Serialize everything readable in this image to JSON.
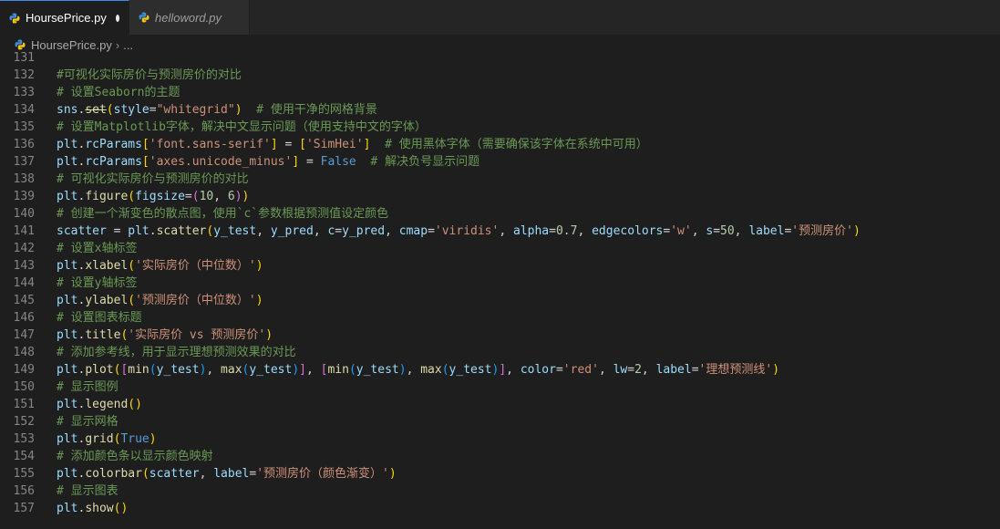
{
  "tabs": [
    {
      "label": "HoursePrice.py",
      "active": true,
      "modified": true
    },
    {
      "label": "helloword.py",
      "active": false,
      "modified": false
    }
  ],
  "breadcrumb": {
    "file": "HoursePrice.py",
    "sep": "›",
    "more": "..."
  },
  "colors": {
    "background": "#1e1e1e",
    "comment": "#6a9955",
    "variable": "#9cdcfe",
    "function": "#dcdcaa",
    "string": "#ce9178",
    "number": "#b5cea8",
    "keyword": "#569cd6"
  },
  "icons": {
    "file_icon": "python-icon",
    "modified_indicator": "dot"
  },
  "editor": {
    "lines": [
      {
        "num": "131",
        "tokens": []
      },
      {
        "num": "132",
        "tokens": [
          {
            "t": "#可视化实际房价与预测房价的对比",
            "c": "c-cm"
          }
        ]
      },
      {
        "num": "133",
        "tokens": [
          {
            "t": "# 设置Seaborn的主题",
            "c": "c-cm"
          }
        ]
      },
      {
        "num": "134",
        "tokens": [
          {
            "t": "sns",
            "c": "c-var"
          },
          {
            "t": ".",
            "c": "c-pl"
          },
          {
            "t": "set",
            "c": "c-fn strike"
          },
          {
            "t": "(",
            "c": "c-br1"
          },
          {
            "t": "style",
            "c": "c-var"
          },
          {
            "t": "=",
            "c": "c-pl"
          },
          {
            "t": "\"whitegrid\"",
            "c": "c-str"
          },
          {
            "t": ")",
            "c": "c-br1"
          },
          {
            "t": "  # 使用干净的网格背景",
            "c": "c-cm"
          }
        ]
      },
      {
        "num": "135",
        "tokens": [
          {
            "t": "# 设置Matplotlib字体，解决中文显示问题（使用支持中文的字体）",
            "c": "c-cm"
          }
        ]
      },
      {
        "num": "136",
        "tokens": [
          {
            "t": "plt",
            "c": "c-var"
          },
          {
            "t": ".",
            "c": "c-pl"
          },
          {
            "t": "rcParams",
            "c": "c-var"
          },
          {
            "t": "[",
            "c": "c-br1"
          },
          {
            "t": "'font.sans-serif'",
            "c": "c-str"
          },
          {
            "t": "]",
            "c": "c-br1"
          },
          {
            "t": " = ",
            "c": "c-pl"
          },
          {
            "t": "[",
            "c": "c-br1"
          },
          {
            "t": "'SimHei'",
            "c": "c-str"
          },
          {
            "t": "]",
            "c": "c-br1"
          },
          {
            "t": "  # 使用黑体字体（需要确保该字体在系统中可用）",
            "c": "c-cm"
          }
        ]
      },
      {
        "num": "137",
        "tokens": [
          {
            "t": "plt",
            "c": "c-var"
          },
          {
            "t": ".",
            "c": "c-pl"
          },
          {
            "t": "rcParams",
            "c": "c-var"
          },
          {
            "t": "[",
            "c": "c-br1"
          },
          {
            "t": "'axes.unicode_minus'",
            "c": "c-str"
          },
          {
            "t": "]",
            "c": "c-br1"
          },
          {
            "t": " = ",
            "c": "c-pl"
          },
          {
            "t": "False",
            "c": "c-kw"
          },
          {
            "t": "  # 解决负号显示问题",
            "c": "c-cm"
          }
        ]
      },
      {
        "num": "138",
        "tokens": [
          {
            "t": "# 可视化实际房价与预测房价的对比",
            "c": "c-cm"
          }
        ]
      },
      {
        "num": "139",
        "tokens": [
          {
            "t": "plt",
            "c": "c-var"
          },
          {
            "t": ".",
            "c": "c-pl"
          },
          {
            "t": "figure",
            "c": "c-fn"
          },
          {
            "t": "(",
            "c": "c-br1"
          },
          {
            "t": "figsize",
            "c": "c-var"
          },
          {
            "t": "=",
            "c": "c-pl"
          },
          {
            "t": "(",
            "c": "c-br2"
          },
          {
            "t": "10",
            "c": "c-num"
          },
          {
            "t": ", ",
            "c": "c-pl"
          },
          {
            "t": "6",
            "c": "c-num"
          },
          {
            "t": ")",
            "c": "c-br2"
          },
          {
            "t": ")",
            "c": "c-br1"
          }
        ]
      },
      {
        "num": "140",
        "tokens": [
          {
            "t": "# 创建一个渐变色的散点图，使用`c`参数根据预测值设定颜色",
            "c": "c-cm"
          }
        ]
      },
      {
        "num": "141",
        "tokens": [
          {
            "t": "scatter",
            "c": "c-var"
          },
          {
            "t": " = ",
            "c": "c-pl"
          },
          {
            "t": "plt",
            "c": "c-var"
          },
          {
            "t": ".",
            "c": "c-pl"
          },
          {
            "t": "scatter",
            "c": "c-fn"
          },
          {
            "t": "(",
            "c": "c-br1"
          },
          {
            "t": "y_test",
            "c": "c-var"
          },
          {
            "t": ", ",
            "c": "c-pl"
          },
          {
            "t": "y_pred",
            "c": "c-var"
          },
          {
            "t": ", ",
            "c": "c-pl"
          },
          {
            "t": "c",
            "c": "c-var"
          },
          {
            "t": "=",
            "c": "c-pl"
          },
          {
            "t": "y_pred",
            "c": "c-var"
          },
          {
            "t": ", ",
            "c": "c-pl"
          },
          {
            "t": "cmap",
            "c": "c-var"
          },
          {
            "t": "=",
            "c": "c-pl"
          },
          {
            "t": "'viridis'",
            "c": "c-str"
          },
          {
            "t": ", ",
            "c": "c-pl"
          },
          {
            "t": "alpha",
            "c": "c-var"
          },
          {
            "t": "=",
            "c": "c-pl"
          },
          {
            "t": "0.7",
            "c": "c-num"
          },
          {
            "t": ", ",
            "c": "c-pl"
          },
          {
            "t": "edgecolors",
            "c": "c-var"
          },
          {
            "t": "=",
            "c": "c-pl"
          },
          {
            "t": "'w'",
            "c": "c-str"
          },
          {
            "t": ", ",
            "c": "c-pl"
          },
          {
            "t": "s",
            "c": "c-var"
          },
          {
            "t": "=",
            "c": "c-pl"
          },
          {
            "t": "50",
            "c": "c-num"
          },
          {
            "t": ", ",
            "c": "c-pl"
          },
          {
            "t": "label",
            "c": "c-var"
          },
          {
            "t": "=",
            "c": "c-pl"
          },
          {
            "t": "'预测房价'",
            "c": "c-str"
          },
          {
            "t": ")",
            "c": "c-br1"
          }
        ]
      },
      {
        "num": "142",
        "tokens": [
          {
            "t": "# 设置x轴标签",
            "c": "c-cm"
          }
        ]
      },
      {
        "num": "143",
        "tokens": [
          {
            "t": "plt",
            "c": "c-var"
          },
          {
            "t": ".",
            "c": "c-pl"
          },
          {
            "t": "xlabel",
            "c": "c-fn"
          },
          {
            "t": "(",
            "c": "c-br1"
          },
          {
            "t": "'实际房价（中位数）'",
            "c": "c-str"
          },
          {
            "t": ")",
            "c": "c-br1"
          }
        ]
      },
      {
        "num": "144",
        "tokens": [
          {
            "t": "# 设置y轴标签",
            "c": "c-cm"
          }
        ]
      },
      {
        "num": "145",
        "tokens": [
          {
            "t": "plt",
            "c": "c-var"
          },
          {
            "t": ".",
            "c": "c-pl"
          },
          {
            "t": "ylabel",
            "c": "c-fn"
          },
          {
            "t": "(",
            "c": "c-br1"
          },
          {
            "t": "'预测房价（中位数）'",
            "c": "c-str"
          },
          {
            "t": ")",
            "c": "c-br1"
          }
        ]
      },
      {
        "num": "146",
        "tokens": [
          {
            "t": "# 设置图表标题",
            "c": "c-cm"
          }
        ]
      },
      {
        "num": "147",
        "tokens": [
          {
            "t": "plt",
            "c": "c-var"
          },
          {
            "t": ".",
            "c": "c-pl"
          },
          {
            "t": "title",
            "c": "c-fn"
          },
          {
            "t": "(",
            "c": "c-br1"
          },
          {
            "t": "'实际房价 vs 预测房价'",
            "c": "c-str"
          },
          {
            "t": ")",
            "c": "c-br1"
          }
        ]
      },
      {
        "num": "148",
        "tokens": [
          {
            "t": "# 添加参考线，用于显示理想预测效果的对比",
            "c": "c-cm"
          }
        ]
      },
      {
        "num": "149",
        "tokens": [
          {
            "t": "plt",
            "c": "c-var"
          },
          {
            "t": ".",
            "c": "c-pl"
          },
          {
            "t": "plot",
            "c": "c-fn"
          },
          {
            "t": "(",
            "c": "c-br1"
          },
          {
            "t": "[",
            "c": "c-br2"
          },
          {
            "t": "min",
            "c": "c-fn"
          },
          {
            "t": "(",
            "c": "c-br3"
          },
          {
            "t": "y_test",
            "c": "c-var"
          },
          {
            "t": ")",
            "c": "c-br3"
          },
          {
            "t": ", ",
            "c": "c-pl"
          },
          {
            "t": "max",
            "c": "c-fn"
          },
          {
            "t": "(",
            "c": "c-br3"
          },
          {
            "t": "y_test",
            "c": "c-var"
          },
          {
            "t": ")",
            "c": "c-br3"
          },
          {
            "t": "]",
            "c": "c-br2"
          },
          {
            "t": ", ",
            "c": "c-pl"
          },
          {
            "t": "[",
            "c": "c-br2"
          },
          {
            "t": "min",
            "c": "c-fn"
          },
          {
            "t": "(",
            "c": "c-br3"
          },
          {
            "t": "y_test",
            "c": "c-var"
          },
          {
            "t": ")",
            "c": "c-br3"
          },
          {
            "t": ", ",
            "c": "c-pl"
          },
          {
            "t": "max",
            "c": "c-fn"
          },
          {
            "t": "(",
            "c": "c-br3"
          },
          {
            "t": "y_test",
            "c": "c-var"
          },
          {
            "t": ")",
            "c": "c-br3"
          },
          {
            "t": "]",
            "c": "c-br2"
          },
          {
            "t": ", ",
            "c": "c-pl"
          },
          {
            "t": "color",
            "c": "c-var"
          },
          {
            "t": "=",
            "c": "c-pl"
          },
          {
            "t": "'red'",
            "c": "c-str"
          },
          {
            "t": ", ",
            "c": "c-pl"
          },
          {
            "t": "lw",
            "c": "c-var"
          },
          {
            "t": "=",
            "c": "c-pl"
          },
          {
            "t": "2",
            "c": "c-num"
          },
          {
            "t": ", ",
            "c": "c-pl"
          },
          {
            "t": "label",
            "c": "c-var"
          },
          {
            "t": "=",
            "c": "c-pl"
          },
          {
            "t": "'理想预测线'",
            "c": "c-str"
          },
          {
            "t": ")",
            "c": "c-br1"
          }
        ]
      },
      {
        "num": "150",
        "tokens": [
          {
            "t": "# 显示图例",
            "c": "c-cm"
          }
        ]
      },
      {
        "num": "151",
        "tokens": [
          {
            "t": "plt",
            "c": "c-var"
          },
          {
            "t": ".",
            "c": "c-pl"
          },
          {
            "t": "legend",
            "c": "c-fn"
          },
          {
            "t": "()",
            "c": "c-br1"
          }
        ]
      },
      {
        "num": "152",
        "tokens": [
          {
            "t": "# 显示网格",
            "c": "c-cm"
          }
        ]
      },
      {
        "num": "153",
        "tokens": [
          {
            "t": "plt",
            "c": "c-var"
          },
          {
            "t": ".",
            "c": "c-pl"
          },
          {
            "t": "grid",
            "c": "c-fn"
          },
          {
            "t": "(",
            "c": "c-br1"
          },
          {
            "t": "True",
            "c": "c-kw"
          },
          {
            "t": ")",
            "c": "c-br1"
          }
        ]
      },
      {
        "num": "154",
        "tokens": [
          {
            "t": "# 添加颜色条以显示颜色映射",
            "c": "c-cm"
          }
        ]
      },
      {
        "num": "155",
        "tokens": [
          {
            "t": "plt",
            "c": "c-var"
          },
          {
            "t": ".",
            "c": "c-pl"
          },
          {
            "t": "colorbar",
            "c": "c-fn"
          },
          {
            "t": "(",
            "c": "c-br1"
          },
          {
            "t": "scatter",
            "c": "c-var"
          },
          {
            "t": ", ",
            "c": "c-pl"
          },
          {
            "t": "label",
            "c": "c-var"
          },
          {
            "t": "=",
            "c": "c-pl"
          },
          {
            "t": "'预测房价（颜色渐变）'",
            "c": "c-str"
          },
          {
            "t": ")",
            "c": "c-br1"
          }
        ]
      },
      {
        "num": "156",
        "tokens": [
          {
            "t": "# 显示图表",
            "c": "c-cm"
          }
        ]
      },
      {
        "num": "157",
        "tokens": [
          {
            "t": "plt",
            "c": "c-var"
          },
          {
            "t": ".",
            "c": "c-pl"
          },
          {
            "t": "show",
            "c": "c-fn"
          },
          {
            "t": "()",
            "c": "c-br1"
          }
        ]
      }
    ]
  }
}
